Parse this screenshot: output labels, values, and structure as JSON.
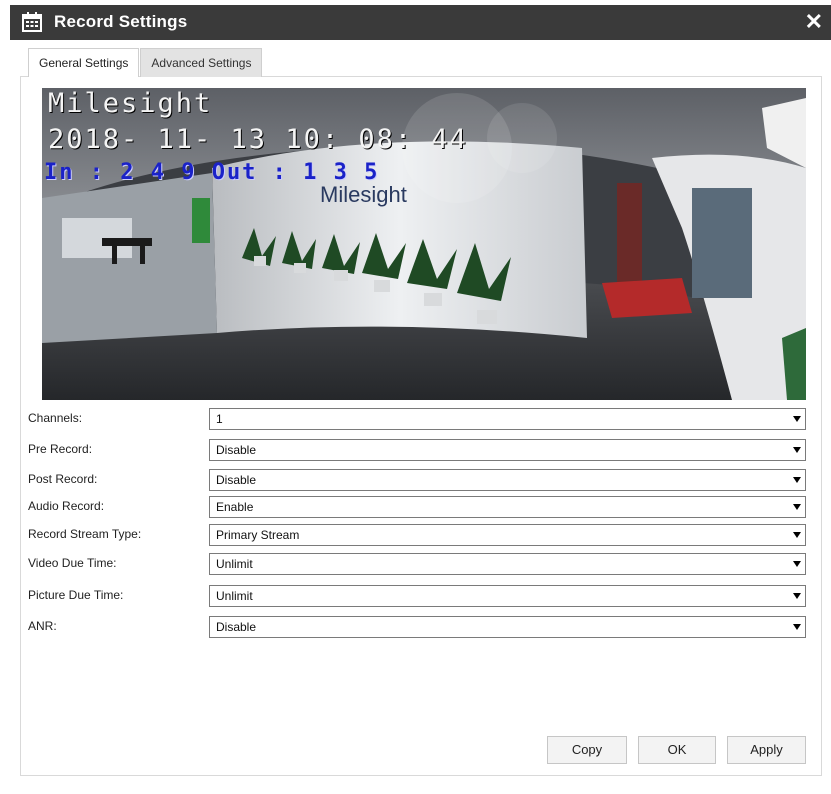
{
  "window": {
    "title": "Record Settings",
    "close_glyph": "✕",
    "title_icon": "calendar-icon"
  },
  "tabs": [
    {
      "label": "General Settings",
      "active": true
    },
    {
      "label": "Advanced Settings",
      "active": false
    }
  ],
  "preview": {
    "osd_brand": "Milesight",
    "osd_timestamp": "2018- 11- 13  10: 08: 44",
    "osd_counter": "In : 2 4 9  Out : 1 3 5",
    "wall_logo": "Milesight"
  },
  "form": [
    {
      "label": "Channels:",
      "value": "1"
    },
    {
      "label": "Pre Record:",
      "value": "Disable"
    },
    {
      "label": "Post Record:",
      "value": "Disable"
    },
    {
      "label": "Audio Record:",
      "value": "Enable"
    },
    {
      "label": "Record Stream Type:",
      "value": "Primary Stream"
    },
    {
      "label": "Video Due Time:",
      "value": "Unlimit"
    },
    {
      "label": "Picture Due Time:",
      "value": "Unlimit"
    },
    {
      "label": "ANR:",
      "value": "Disable"
    }
  ],
  "buttons": {
    "copy": "Copy",
    "ok": "OK",
    "apply": "Apply"
  },
  "colors": {
    "titlebar": "#3a3a3a",
    "counter_osd": "#1a22c8"
  }
}
